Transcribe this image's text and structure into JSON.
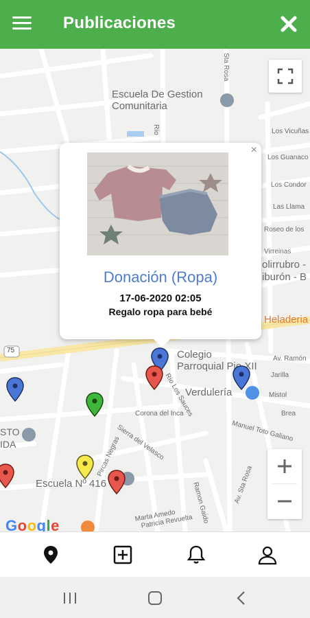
{
  "appbar": {
    "title": "Publicaciones"
  },
  "map": {
    "labels": {
      "escuela_gestion": "Escuela De Gestion\nComunitaria",
      "colegio": "Colegio\nParroquial Pio XII",
      "verduleria": "Verdulería",
      "escuela_416": "Escuela Nº 416",
      "heladeria": "Heladeria",
      "polirrubro": "olirrubro -",
      "tiburon": "iburón - B",
      "sta_rosa": "Sta Rosa",
      "las_vicunas": "Los Vicuñas",
      "los_guanacos": "Los Guanaco",
      "los_condores": "Los Condor",
      "las_llamas": "Las Llama",
      "roseo": "Roseo de los",
      "virreinas": "Virreinas",
      "av_ramon": "Av. Ramón",
      "jarilla": "Jarilla",
      "mistol": "Mistol",
      "brea": "Brea",
      "corona_inca": "Corona del Inca",
      "sierra_velasco": "Sierra del Velasco",
      "pircas_negras": "Pircas Negras",
      "manuel_toto": "Manuel Toto Galiano",
      "av_sta_rosa": "Av. Sta Rosa",
      "marta_amedo": "Marta Amedo",
      "ramon_gaido": "Ramon Gaido",
      "patricia": "Patricia Revuelta",
      "rio_los_sauces": "Río Los Sauces",
      "rio": "Río",
      "ruta": "75",
      "huasto": "STO",
      "cida": "IDA",
      "google": "Google"
    },
    "markers": [
      {
        "name": "blue",
        "color": "#4a76d6"
      },
      {
        "name": "red",
        "color": "#e8574d"
      },
      {
        "name": "green",
        "color": "#3fb53b"
      },
      {
        "name": "yellow",
        "color": "#f5e94c"
      }
    ]
  },
  "popup": {
    "title": "Donación (Ropa)",
    "date": "17-06-2020 02:05",
    "description": "Regalo ropa para bebé",
    "close": "×"
  },
  "nav": {
    "items": [
      "location-icon",
      "add-icon",
      "bell-icon",
      "profile-icon"
    ]
  },
  "colors": {
    "brand": "#4caf4c",
    "link": "#4f7ccd"
  }
}
